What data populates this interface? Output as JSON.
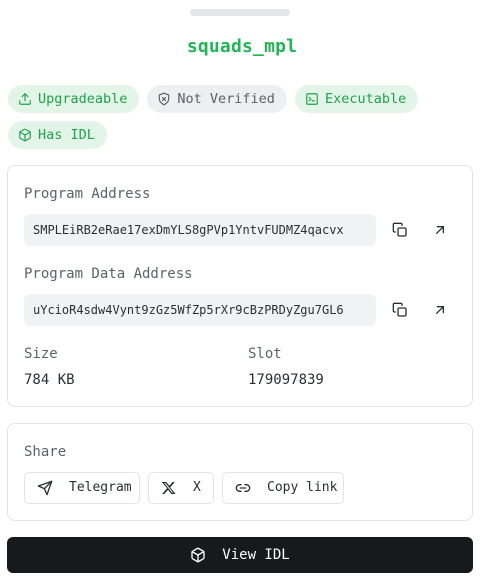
{
  "program": {
    "name": "squads_mpl"
  },
  "badges": [
    {
      "label": "Upgradeable",
      "icon": "upload-icon",
      "color": "#21a14b"
    },
    {
      "label": "Not Verified",
      "icon": "shield-x-icon",
      "color": "#5b6168"
    },
    {
      "label": "Executable",
      "icon": "terminal-icon",
      "color": "#21a14b"
    },
    {
      "label": "Has IDL",
      "icon": "cube-icon",
      "color": "#21a14b"
    }
  ],
  "details": {
    "program_address_label": "Program Address",
    "program_address": "SMPLEiRB2eRae17exDmYLS8gPVp1YntvFUDMZ4qacvx",
    "program_data_address_label": "Program Data Address",
    "program_data_address": "uYcioR4sdw4Vynt9zGz5WfZp5rXr9cBzPRDyZgu7GL6",
    "size_label": "Size",
    "size": "784 KB",
    "slot_label": "Slot",
    "slot": "179097839"
  },
  "share": {
    "title": "Share",
    "telegram_label": "Telegram",
    "x_label": "X",
    "copy_link_label": "Copy link"
  },
  "actions": {
    "view_idl_label": "View IDL"
  },
  "colors": {
    "accent": "#22b455",
    "badge_green_bg": "#e3f5e8",
    "badge_gray_bg": "#eeeff1",
    "primary_button": "#17191c"
  }
}
